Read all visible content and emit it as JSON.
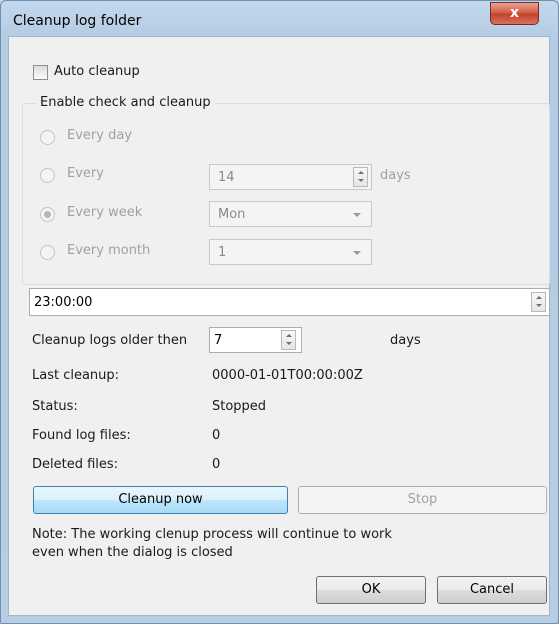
{
  "window": {
    "title": "Cleanup log folder",
    "close_glyph": "x"
  },
  "auto_cleanup": {
    "label": "Auto cleanup",
    "checked": false
  },
  "group": {
    "label": "Enable check and cleanup",
    "every_day": "Every day",
    "every": "Every",
    "every_value": "14",
    "every_unit": "days",
    "every_week": "Every week",
    "week_value": "Mon",
    "every_month": "Every month",
    "month_value": "1",
    "selected": "every_week"
  },
  "time": {
    "value": "23:00:00"
  },
  "older": {
    "label": "Cleanup logs older then",
    "value": "7",
    "unit": "days"
  },
  "info": {
    "last_cleanup_label": "Last cleanup:",
    "last_cleanup_value": "0000-01-01T00:00:00Z",
    "status_label": "Status:",
    "status_value": "Stopped",
    "found_label": "Found log files:",
    "found_value": "0",
    "deleted_label": "Deleted files:",
    "deleted_value": "0"
  },
  "buttons": {
    "cleanup_now": "Cleanup now",
    "stop": "Stop",
    "ok": "OK",
    "cancel": "Cancel"
  },
  "note": {
    "line1": "Note: The working clenup process will continue to work",
    "line2": "even when the dialog is closed"
  }
}
